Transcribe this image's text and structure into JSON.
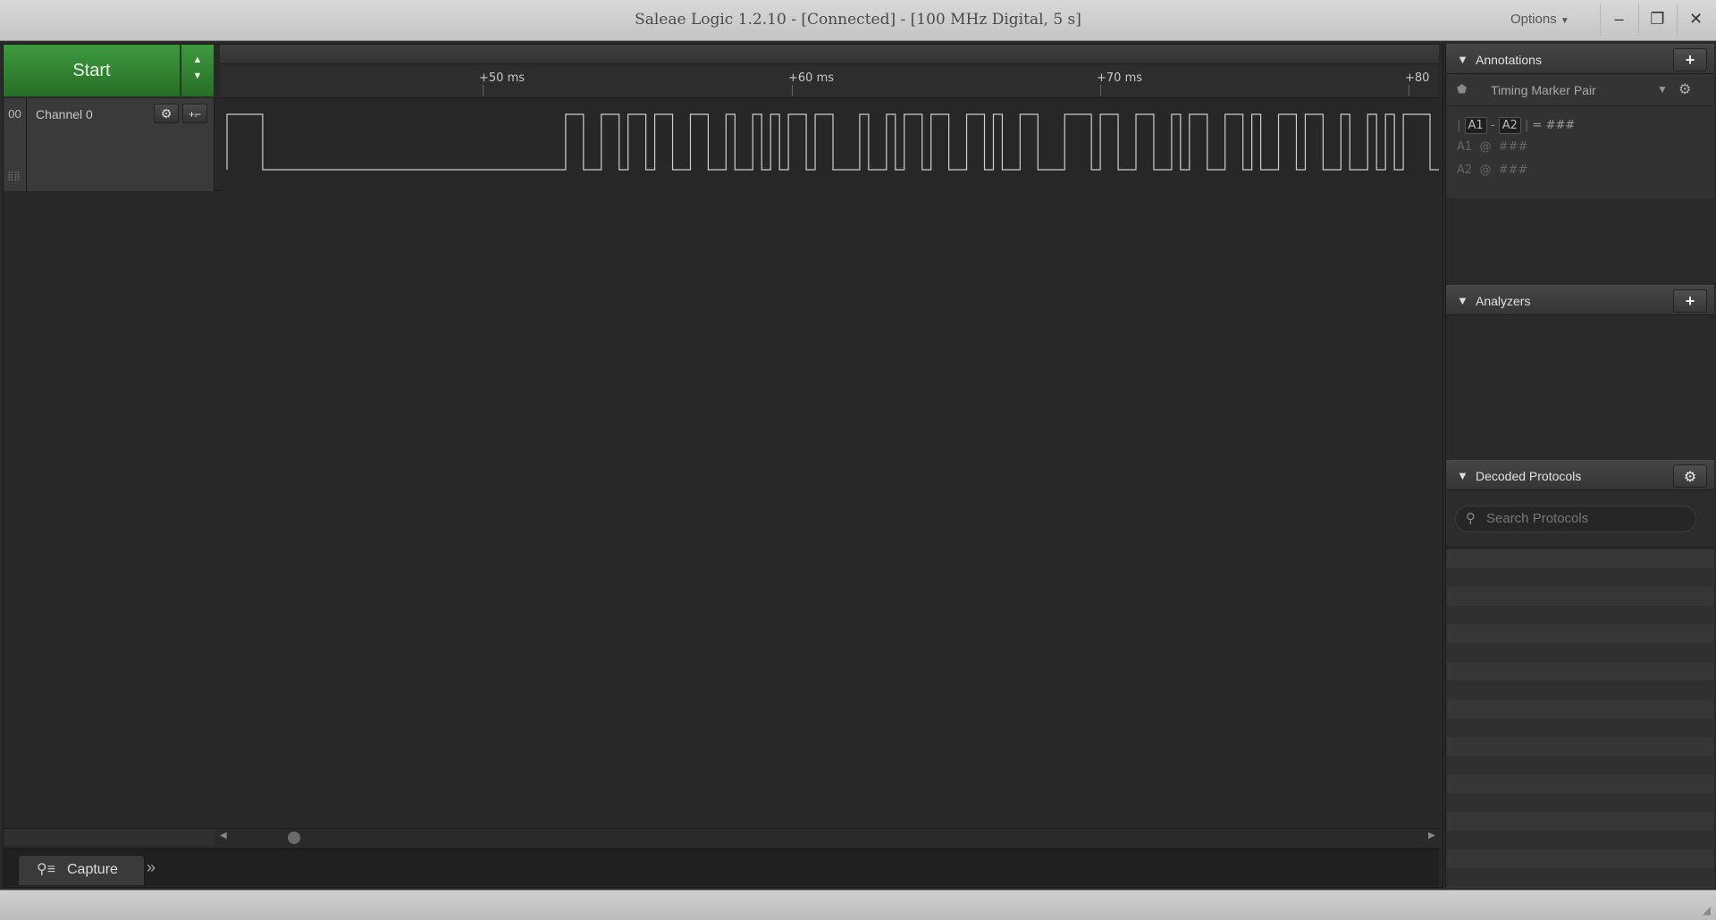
{
  "window": {
    "title": "Saleae Logic 1.2.10 - [Connected] - [100 MHz Digital, 5 s]",
    "options_label": "Options",
    "minimize_glyph": "–",
    "restore_glyph": "❐",
    "close_glyph": "✕"
  },
  "capture_control": {
    "start_label": "Start"
  },
  "timeline": {
    "ticks": [
      "+50 ms",
      "+60 ms",
      "+70 ms",
      "+80"
    ]
  },
  "channels": [
    {
      "index": "00",
      "name": "Channel 0",
      "settings_icon": "gear-icon",
      "trigger_icon": "trigger-edge-icon"
    }
  ],
  "signal_levels": "0000111111111111111111111111111111111100110010010011001101101010010011101101001001100101100111000100110011010011001011001001101101010001",
  "bottom_tabs": {
    "capture_label": "Capture"
  },
  "sidebar": {
    "annotations": {
      "title": "Annotations",
      "marker_name": "Timing Marker Pair",
      "pair_line": {
        "a1": "A1",
        "dash": "-",
        "a2": "A2",
        "equals": "=",
        "value": "###"
      },
      "a1_line": {
        "label": "A1",
        "at": "@",
        "value": "###"
      },
      "a2_line": {
        "label": "A2",
        "at": "@",
        "value": "###"
      }
    },
    "analyzers": {
      "title": "Analyzers"
    },
    "decoded_protocols": {
      "title": "Decoded Protocols",
      "search_placeholder": "Search Protocols"
    }
  },
  "colors": {
    "start_green": "#3e9a3e",
    "background": "#282828",
    "waveform": "#d0d0d0"
  }
}
